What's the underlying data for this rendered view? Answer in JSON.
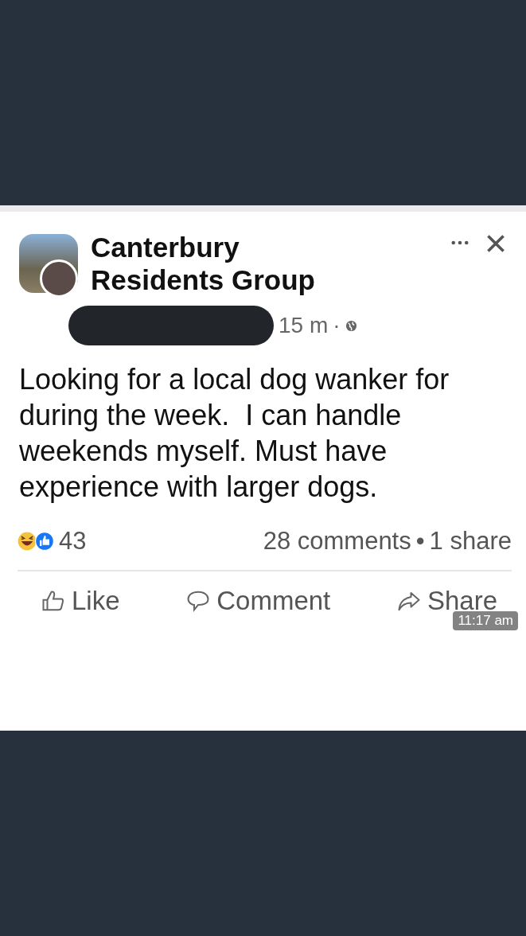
{
  "post": {
    "group_name": "Canterbury Residents Group",
    "time": "15 m",
    "separator": "·",
    "text": "Looking for a local dog wanker for during the week.  I can handle weekends myself. Must have experience with larger dogs.",
    "reaction_count": "43",
    "comments": "28 comments",
    "dot": "•",
    "shares": "1 share",
    "actions": [
      {
        "kind": "like",
        "label": "Like"
      },
      {
        "kind": "comment",
        "label": "Comment"
      },
      {
        "kind": "share",
        "label": "Share"
      }
    ]
  },
  "overlay_time": "11:17 am"
}
